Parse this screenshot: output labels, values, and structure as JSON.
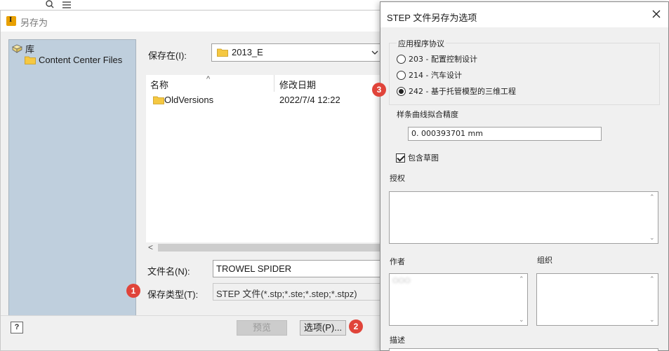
{
  "saveas": {
    "title": "另存为",
    "places": {
      "library": "库",
      "content_center": "Content Center Files"
    },
    "save_in_label": "保存在(I):",
    "save_in_value": "2013_E",
    "columns": {
      "name": "名称",
      "modified": "修改日期"
    },
    "files": [
      {
        "name": "OldVersions",
        "date": "2022/7/4 12:22"
      }
    ],
    "filename_label": "文件名(N):",
    "filename_value": "TROWEL SPIDER",
    "filetype_label": "保存类型(T):",
    "filetype_value": "STEP 文件(*.stp;*.ste;*.step;*.stpz)",
    "preview_button": "预览",
    "options_button": "选项(P)...",
    "help_button": "?"
  },
  "badges": {
    "b1": "1",
    "b2": "2",
    "b3": "3"
  },
  "step_options": {
    "title": "STEP 文件另存为选项",
    "protocol_group": "应用程序协议",
    "protocols": [
      {
        "label": "203 - 配置控制设计",
        "selected": false
      },
      {
        "label": "214 - 汽车设计",
        "selected": false
      },
      {
        "label": "242 - 基于托管模型的三维工程",
        "selected": true
      }
    ],
    "spline_label": "样条曲线拟合精度",
    "spline_value": "0. 000393701 mm",
    "include_sketch_label": "包含草图",
    "include_sketch_checked": true,
    "authorization_label": "授权",
    "author_label": "作者",
    "author_value": "OOO",
    "organization_label": "组织",
    "description_label": "描述"
  },
  "colors": {
    "badge": "#e0443a",
    "places_bg": "#bfcfdd",
    "folder": "#f5c842"
  }
}
